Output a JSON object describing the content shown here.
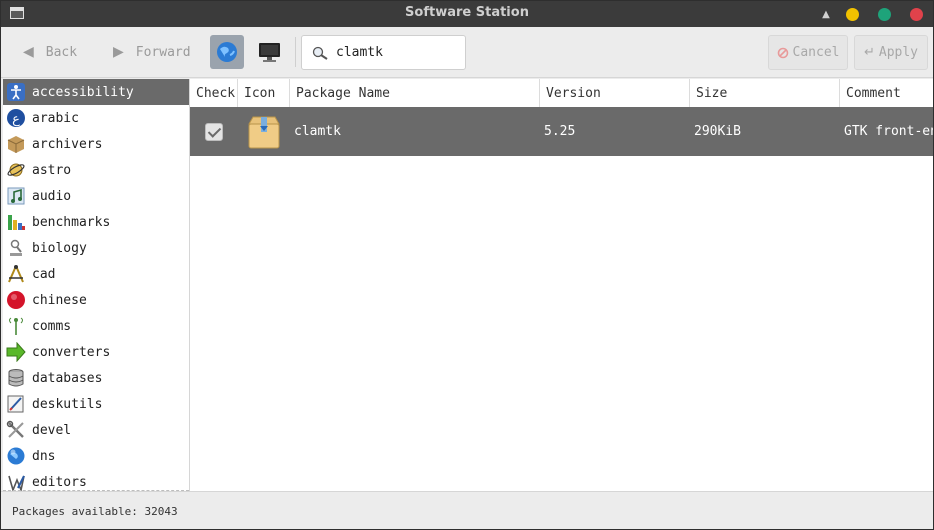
{
  "window": {
    "title": "Software Station"
  },
  "toolbar": {
    "back_label": "Back",
    "forward_label": "Forward",
    "search_value": "clamtk",
    "cancel_label": "Cancel",
    "apply_label": "Apply"
  },
  "sidebar": {
    "items": [
      {
        "label": "accessibility",
        "icon": "accessibility-icon",
        "selected": true
      },
      {
        "label": "arabic",
        "icon": "arabic-icon"
      },
      {
        "label": "archivers",
        "icon": "archive-box-icon"
      },
      {
        "label": "astro",
        "icon": "planet-icon"
      },
      {
        "label": "audio",
        "icon": "music-icon"
      },
      {
        "label": "benchmarks",
        "icon": "bar-chart-icon"
      },
      {
        "label": "biology",
        "icon": "microscope-icon"
      },
      {
        "label": "cad",
        "icon": "compass-icon"
      },
      {
        "label": "chinese",
        "icon": "red-circle-icon"
      },
      {
        "label": "comms",
        "icon": "antenna-icon"
      },
      {
        "label": "converters",
        "icon": "green-arrow-icon"
      },
      {
        "label": "databases",
        "icon": "database-icon"
      },
      {
        "label": "deskutils",
        "icon": "notepad-icon"
      },
      {
        "label": "devel",
        "icon": "tools-icon"
      },
      {
        "label": "dns",
        "icon": "globe-icon"
      },
      {
        "label": "editors",
        "icon": "editor-icon"
      }
    ]
  },
  "table": {
    "columns": [
      "Check",
      "Icon",
      "Package Name",
      "Version",
      "Size",
      "Comment"
    ],
    "rows": [
      {
        "checked": true,
        "name": "clamtk",
        "version": "5.25",
        "size": "290KiB",
        "comment": "GTK front-end"
      }
    ]
  },
  "status": {
    "text": "Packages available: 32043"
  },
  "colors": {
    "selection": "#6a6a6a",
    "titlebar": "#3b3b3b",
    "accent_blue": "#2b7bd4"
  }
}
